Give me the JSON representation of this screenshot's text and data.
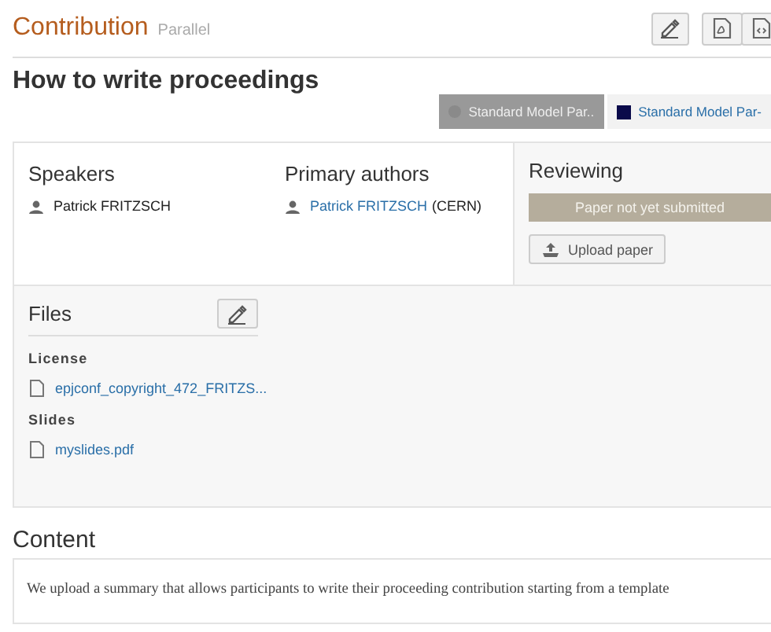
{
  "header": {
    "title": "Contribution",
    "subtitle": "Parallel"
  },
  "toolbar": [
    {
      "kind": "edit"
    },
    {
      "kind": "pdf"
    },
    {
      "kind": "xml"
    }
  ],
  "contribution_title": "How to write proceedings",
  "tags": [
    {
      "label": "Standard Model Par..",
      "selected": true,
      "color": "#8a8a8a"
    },
    {
      "label": "Standard Model Par-",
      "selected": false,
      "color": "#0a0a4a"
    }
  ],
  "speakers": {
    "heading": "Speakers",
    "people": [
      {
        "name": "Patrick FRITZSCH"
      }
    ]
  },
  "primary_authors": {
    "heading": "Primary authors",
    "people": [
      {
        "name": "Patrick FRITZSCH",
        "affiliation": "(CERN)"
      }
    ]
  },
  "reviewing": {
    "heading": "Reviewing",
    "status": "Paper not yet submitted",
    "button": "Upload paper"
  },
  "files": {
    "heading": "Files",
    "groups": [
      {
        "label": "License",
        "files": [
          "epjconf_copyright_472_FRITZS..."
        ]
      },
      {
        "label": "Slides",
        "files": [
          "myslides.pdf"
        ]
      }
    ]
  },
  "content": {
    "heading": "Content",
    "text": "We upload a summary that allows participants to write their proceeding contribution starting from a template"
  }
}
